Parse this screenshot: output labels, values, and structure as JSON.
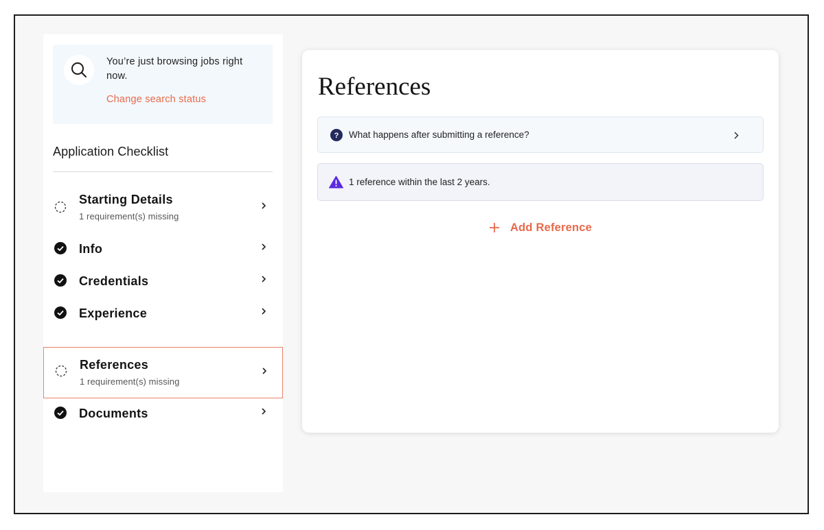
{
  "status_card": {
    "text": "You’re just browsing jobs right now.",
    "link": "Change search status"
  },
  "checklist": {
    "title": "Application Checklist",
    "items": [
      {
        "label": "Starting Details",
        "sub": "1 requirement(s) missing",
        "state": "incomplete"
      },
      {
        "label": "Info",
        "sub": "",
        "state": "complete"
      },
      {
        "label": "Credentials",
        "sub": "",
        "state": "complete"
      },
      {
        "label": "Experience",
        "sub": "",
        "state": "complete"
      },
      {
        "label": "References",
        "sub": "1 requirement(s) missing",
        "state": "incomplete",
        "active": true
      },
      {
        "label": "Documents",
        "sub": "",
        "state": "complete"
      }
    ]
  },
  "main": {
    "title": "References",
    "faq": "What happens after submitting a reference?",
    "warning": "1 reference within the last 2 years.",
    "add_button": "Add Reference"
  },
  "colors": {
    "accent": "#e8694a",
    "warning_icon": "#5b2be0",
    "question_icon": "#232a5c",
    "active_border": "#e8826a"
  },
  "icons": {
    "search": "search-icon",
    "incomplete": "dashed-circle-icon",
    "complete": "check-circle-icon",
    "chevron": "chevron-right-icon",
    "question": "question-circle-icon",
    "warning": "warning-triangle-icon",
    "plus": "plus-icon"
  }
}
